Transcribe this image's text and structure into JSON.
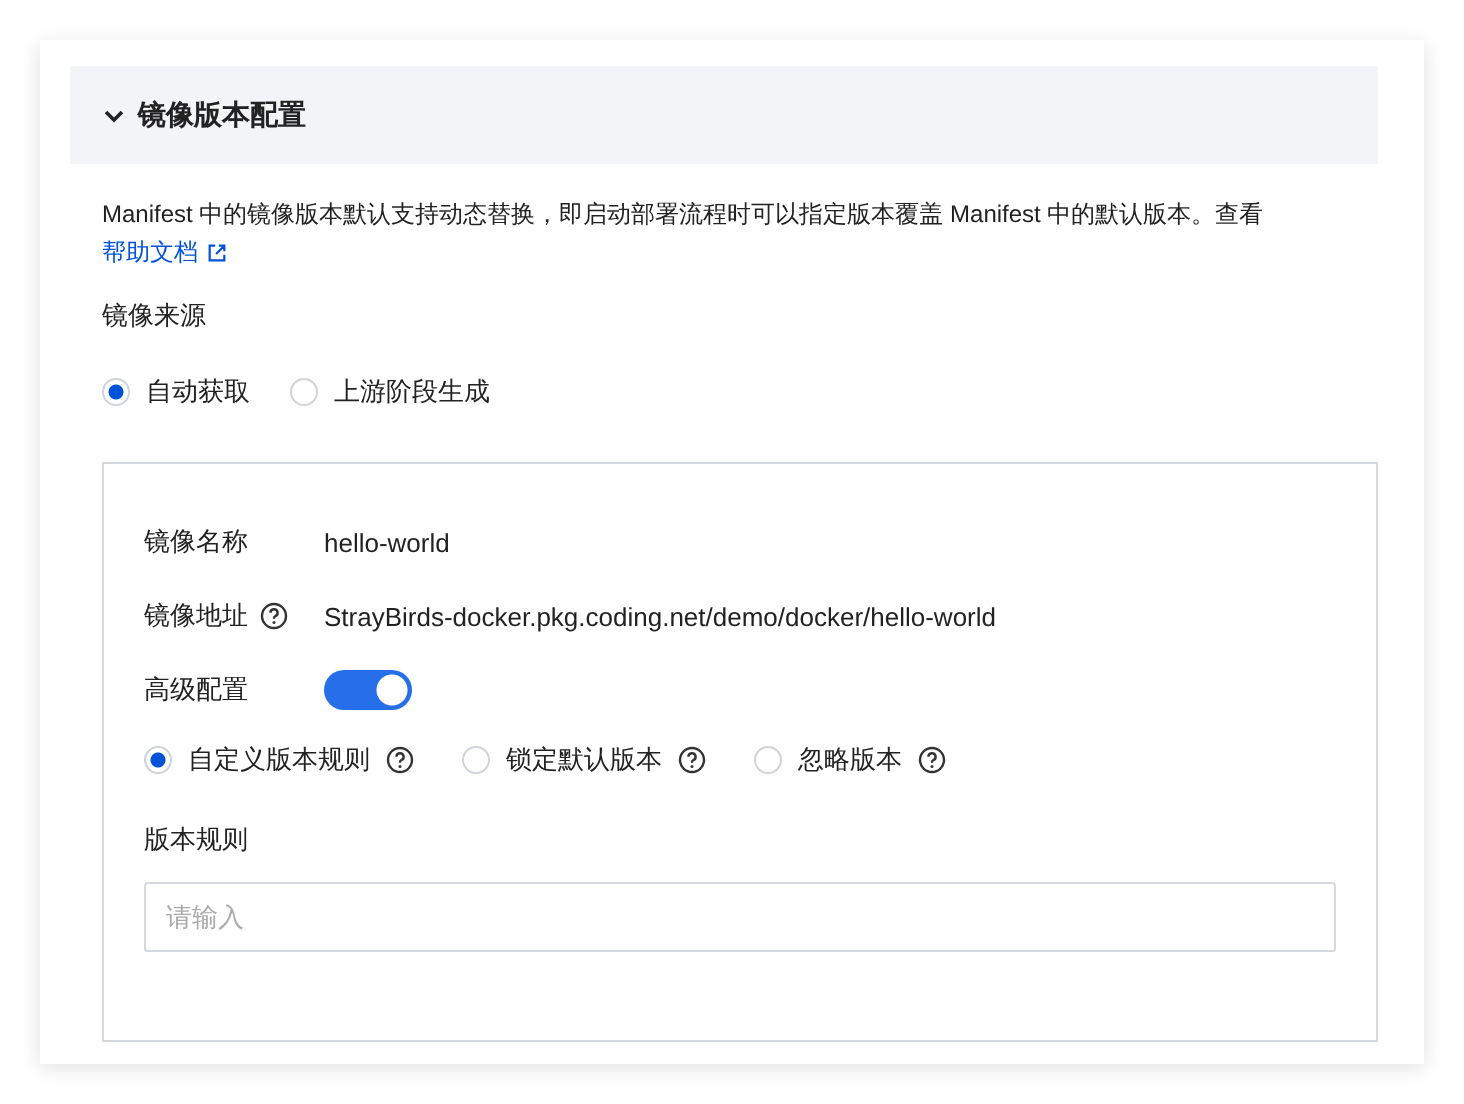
{
  "section": {
    "title": "镜像版本配置",
    "expanded": true,
    "description": "Manifest 中的镜像版本默认支持动态替换，即启动部署流程时可以指定版本覆盖 Manifest 中的默认版本。查看",
    "help_link": "帮助文档",
    "source_label": "镜像来源",
    "source_options": [
      {
        "label": "自动获取",
        "selected": true
      },
      {
        "label": "上游阶段生成",
        "selected": false
      }
    ],
    "details": [
      {
        "label": "镜像名称",
        "value": "hello-world",
        "help": false
      },
      {
        "label": "镜像地址",
        "value": "StrayBirds-docker.pkg.coding.net/demo/docker/hello-world",
        "help": true
      }
    ],
    "advanced": {
      "label": "高级配置",
      "on": true
    },
    "version_modes": [
      {
        "label": "自定义版本规则",
        "selected": true
      },
      {
        "label": "锁定默认版本",
        "selected": false
      },
      {
        "label": "忽略版本",
        "selected": false
      }
    ],
    "rule_field": {
      "label": "版本规则",
      "placeholder": "请输入"
    }
  }
}
